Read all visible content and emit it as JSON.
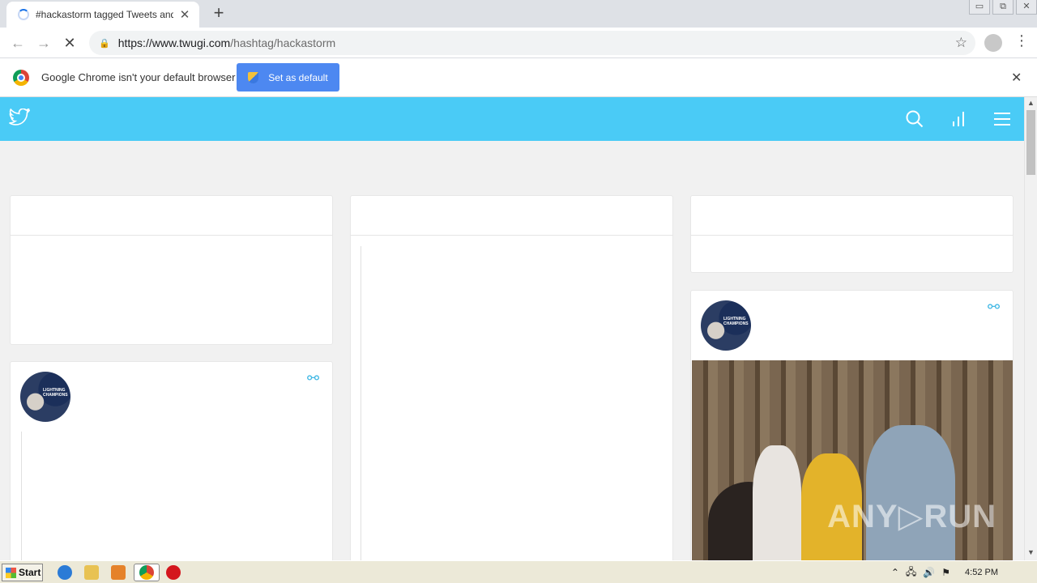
{
  "browser": {
    "tab_title": "#hackastorm tagged Tweets and Do",
    "tab_close": "✕",
    "new_tab": "+",
    "window_controls": [
      "▭",
      "⧉",
      "✕"
    ],
    "back": "←",
    "forward": "→",
    "reload": "✕",
    "url_host": "https://www.twugi.com",
    "url_path": "/hashtag/hackastorm",
    "bookmark_star": "☆",
    "menu": "⋮"
  },
  "infobar": {
    "message": "Google Chrome isn't your default browser",
    "button_label": "Set as default",
    "close": "✕"
  },
  "site": {
    "brand_color": "#4acbf6",
    "accent_color": "#43b9e5",
    "icons": [
      "twitter-bird-icon",
      "search-icon",
      "stats-icon",
      "hamburger-menu-icon"
    ],
    "link_glyph": "⚯",
    "avatar_text": "LIGHTNING\nCHAMPIONS",
    "watermark": "ANY▷RUN"
  },
  "taskbar": {
    "start_label": "Start",
    "clock": "4:52 PM"
  }
}
